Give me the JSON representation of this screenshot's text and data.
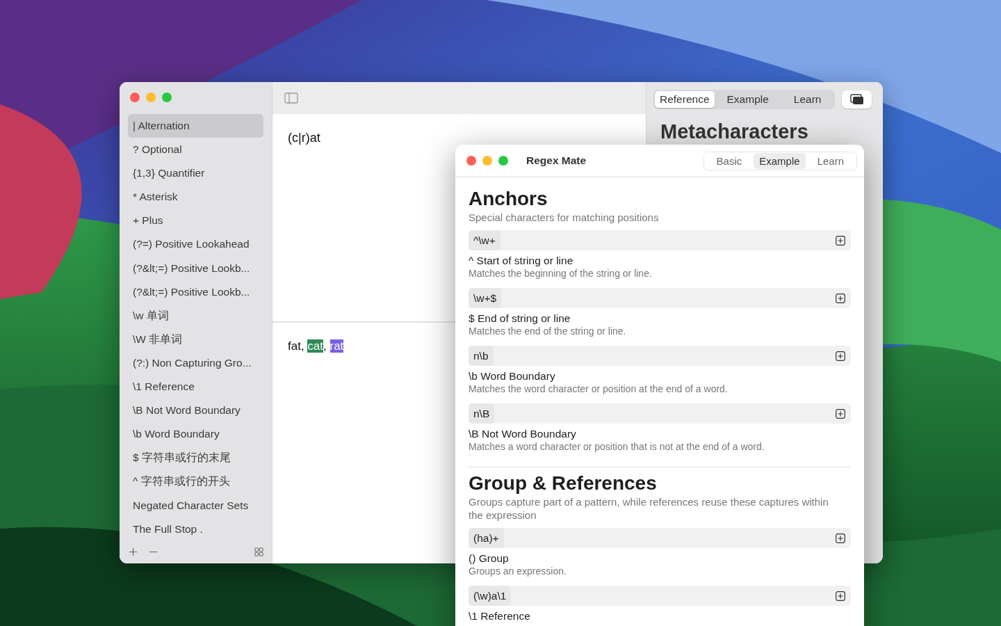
{
  "back_window": {
    "sidebar": {
      "items": [
        {
          "label": "| Alternation",
          "selected": true
        },
        {
          "label": "? Optional",
          "selected": false
        },
        {
          "label": "{1,3} Quantifier",
          "selected": false
        },
        {
          "label": "* Asterisk",
          "selected": false
        },
        {
          "label": "+ Plus",
          "selected": false
        },
        {
          "label": "(?=) Positive Lookahead",
          "selected": false
        },
        {
          "label": "(?&lt;=) Positive Lookb...",
          "selected": false
        },
        {
          "label": "(?&lt;=) Positive Lookb...",
          "selected": false
        },
        {
          "label": "\\w 单词",
          "selected": false
        },
        {
          "label": "\\W 非单词",
          "selected": false
        },
        {
          "label": "(?:) Non Capturing Gro...",
          "selected": false
        },
        {
          "label": "\\1 Reference",
          "selected": false
        },
        {
          "label": "\\B Not Word Boundary",
          "selected": false
        },
        {
          "label": "\\b Word Boundary",
          "selected": false
        },
        {
          "label": "$ 字符串或行的末尾",
          "selected": false
        },
        {
          "label": "^ 字符串或行的开头",
          "selected": false
        },
        {
          "label": "Negated Character Sets",
          "selected": false
        },
        {
          "label": "The Full Stop .",
          "selected": false
        }
      ]
    },
    "pattern": "(c|r)at",
    "test_text": [
      {
        "text": "fat, "
      },
      {
        "text": "cat",
        "color": "#2f8a55"
      },
      {
        "text": ", "
      },
      {
        "text": "rat",
        "color": "#7a5fe0"
      }
    ],
    "tabs": [
      {
        "label": "Reference",
        "selected": true
      },
      {
        "label": "Example",
        "selected": false
      },
      {
        "label": "Learn",
        "selected": false
      }
    ],
    "panel_title": "Metacharacters"
  },
  "front_window": {
    "title": "Regex Mate",
    "tabs": [
      {
        "label": "Basic",
        "selected": false
      },
      {
        "label": "Example",
        "selected": true
      },
      {
        "label": "Learn",
        "selected": false
      }
    ],
    "sections": [
      {
        "title": "Anchors",
        "subtitle": "Special characters for matching positions",
        "entries": [
          {
            "code": "^\\w+",
            "title": "^ Start of string or line",
            "description": "Matches the beginning of the string or line."
          },
          {
            "code": "\\w+$",
            "title": "$ End of string or line",
            "description": "Matches the end of the string or line."
          },
          {
            "code": "n\\b",
            "title": "\\b Word Boundary",
            "description": "Matches the word character or position at the end of a word."
          },
          {
            "code": "n\\B",
            "title": "\\B Not Word Boundary",
            "description": "Matches a word character or position that is not at the end of a word."
          }
        ]
      },
      {
        "title": "Group & References",
        "subtitle": "Groups capture part of a pattern, while references reuse these captures within the expression",
        "entries": [
          {
            "code": "(ha)+",
            "title": "() Group",
            "description": "Groups an expression."
          },
          {
            "code": "(\\w)a\\1",
            "title": "\\1 Reference"
          }
        ]
      }
    ]
  }
}
